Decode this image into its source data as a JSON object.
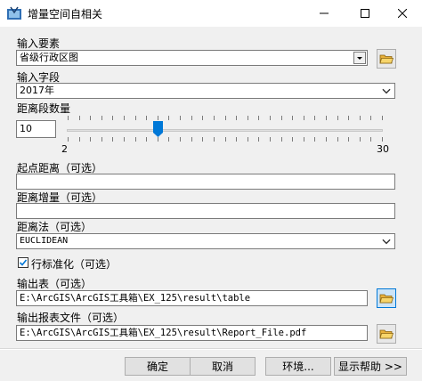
{
  "window": {
    "title": "增量空间自相关",
    "minimize_glyph": "—",
    "maximize_glyph": "☐",
    "close_glyph": "✕",
    "app_icon": "arcgis-toolbox-icon"
  },
  "form": {
    "input_features": {
      "label": "输入要素",
      "value": "省级行政区图"
    },
    "input_field": {
      "label": "输入字段",
      "value": "2017年"
    },
    "num_distance_bands": {
      "label": "距离段数量",
      "value": "10",
      "slider_min": "2",
      "slider_max": "30",
      "slider_value": 10
    },
    "beginning_distance": {
      "label": "起点距离（可选）",
      "value": ""
    },
    "distance_increment": {
      "label": "距离增量（可选）",
      "value": ""
    },
    "distance_method": {
      "label": "距离法（可选）",
      "value": "EUCLIDEAN"
    },
    "row_standardization": {
      "label": "行标准化（可选）",
      "checked": true
    },
    "output_table": {
      "label": "输出表（可选）",
      "value": "E:\\ArcGIS\\ArcGIS工具箱\\EX_125\\result\\table"
    },
    "output_report": {
      "label": "输出报表文件（可选）",
      "value": "E:\\ArcGIS\\ArcGIS工具箱\\EX_125\\result\\Report_File.pdf"
    }
  },
  "buttons": {
    "ok": "确定",
    "cancel": "取消",
    "environments": "环境...",
    "show_help": "显示帮助 >>"
  },
  "colors": {
    "accent": "#0078d7",
    "background": "#f0f0f0"
  }
}
